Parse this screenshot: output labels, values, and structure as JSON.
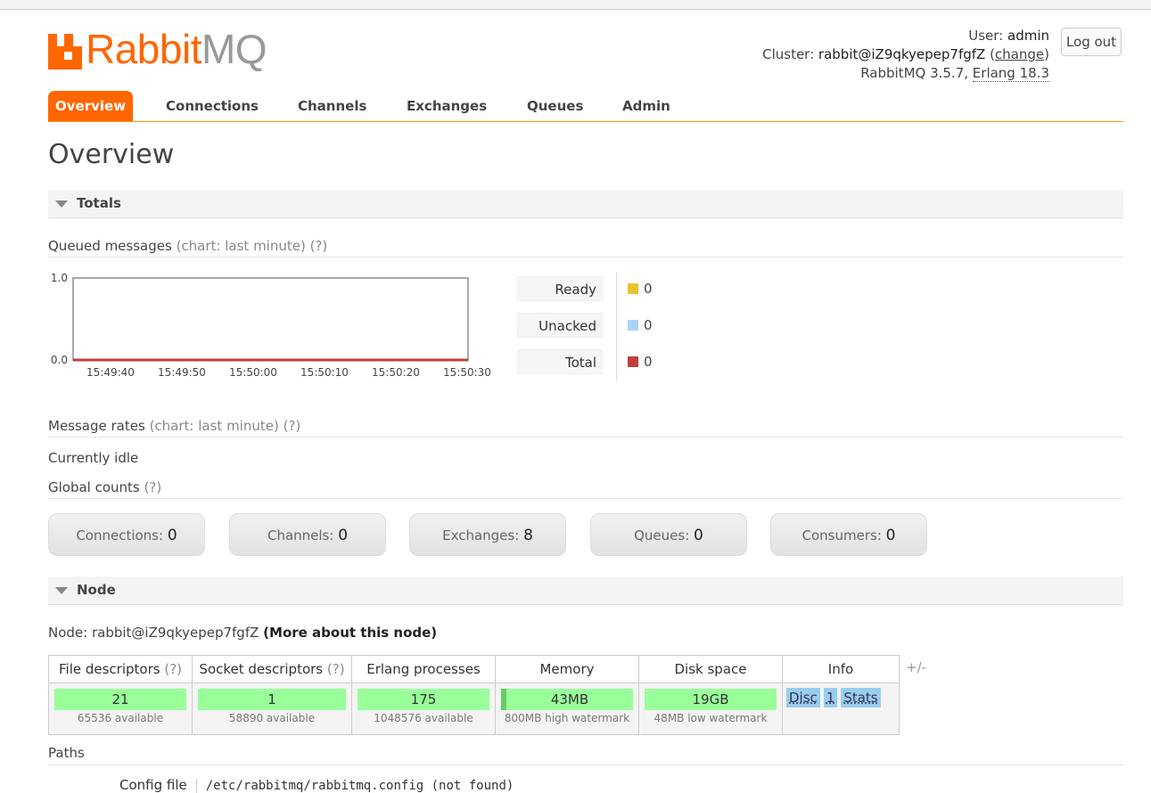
{
  "header": {
    "logo_primary": "Rabbit",
    "logo_secondary": "MQ",
    "user_label": "User:",
    "user_value": "admin",
    "cluster_label": "Cluster:",
    "cluster_value": "rabbit@iZ9qkyepep7fgfZ",
    "change_link": "change",
    "version_text": "RabbitMQ 3.5.7,",
    "erlang_text": "Erlang 18.3",
    "logout_label": "Log out"
  },
  "tabs": [
    {
      "label": "Overview"
    },
    {
      "label": "Connections"
    },
    {
      "label": "Channels"
    },
    {
      "label": "Exchanges"
    },
    {
      "label": "Queues"
    },
    {
      "label": "Admin"
    }
  ],
  "page_title": "Overview",
  "totals": {
    "heading": "Totals",
    "queued_label": "Queued messages",
    "queued_chart_note": "(chart: last minute)",
    "help": "(?)",
    "legend": [
      {
        "label": "Ready",
        "value": "0",
        "color": "#e6c42e"
      },
      {
        "label": "Unacked",
        "value": "0",
        "color": "#a8d4f2"
      },
      {
        "label": "Total",
        "value": "0",
        "color": "#c04040"
      }
    ],
    "rates_label": "Message rates",
    "rates_chart_note": "(chart: last minute)",
    "idle_text": "Currently idle",
    "global_label": "Global counts",
    "counts": [
      {
        "label": "Connections:",
        "value": "0"
      },
      {
        "label": "Channels:",
        "value": "0"
      },
      {
        "label": "Exchanges:",
        "value": "8"
      },
      {
        "label": "Queues:",
        "value": "0"
      },
      {
        "label": "Consumers:",
        "value": "0"
      }
    ]
  },
  "chart_data": {
    "type": "line",
    "x": [
      "15:49:40",
      "15:49:50",
      "15:50:00",
      "15:50:10",
      "15:50:20",
      "15:50:30"
    ],
    "series": [
      {
        "name": "Ready",
        "values": [
          0,
          0,
          0,
          0,
          0,
          0
        ],
        "color": "#e6c42e"
      },
      {
        "name": "Unacked",
        "values": [
          0,
          0,
          0,
          0,
          0,
          0
        ],
        "color": "#a8d4f2"
      },
      {
        "name": "Total",
        "values": [
          0,
          0,
          0,
          0,
          0,
          0
        ],
        "color": "#c04040"
      }
    ],
    "yticks": [
      "1.0",
      "0.0"
    ],
    "ylim": [
      0,
      1
    ],
    "title": "",
    "xlabel": "",
    "ylabel": ""
  },
  "node": {
    "heading": "Node",
    "node_label": "Node:",
    "node_name": "rabbit@iZ9qkyepep7fgfZ",
    "more_link": "(More about this node)",
    "columns": {
      "file_desc": "File descriptors",
      "socket_desc": "Socket descriptors",
      "erlang_proc": "Erlang processes",
      "memory": "Memory",
      "disk": "Disk space",
      "info": "Info"
    },
    "values": {
      "file_desc": "21",
      "file_desc_sub": "65536 available",
      "socket_desc": "1",
      "socket_desc_sub": "58890 available",
      "erlang_proc": "175",
      "erlang_proc_sub": "1048576 available",
      "memory": "43MB",
      "memory_sub": "800MB high watermark",
      "disk": "19GB",
      "disk_sub": "48MB low watermark"
    },
    "info_tags": [
      "Disc",
      "1",
      "Stats"
    ],
    "plus_minus": "+/-"
  },
  "paths": {
    "label": "Paths",
    "config_label": "Config file",
    "config_value": "/etc/rabbitmq/rabbitmq.config (not found)"
  }
}
